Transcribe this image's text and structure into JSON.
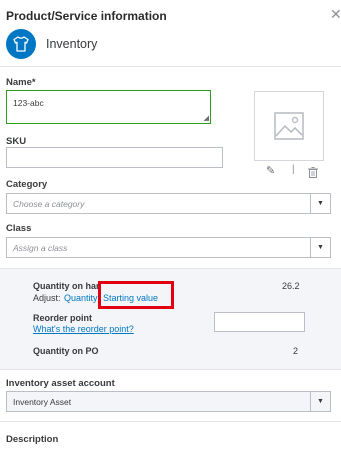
{
  "header": {
    "title": "Product/Service information"
  },
  "item_type": {
    "label": "Inventory"
  },
  "name": {
    "label": "Name*",
    "value": "123-abc"
  },
  "sku": {
    "label": "SKU",
    "value": ""
  },
  "category": {
    "label": "Category",
    "placeholder": "Choose a category"
  },
  "class": {
    "label": "Class",
    "placeholder": "Assign a class"
  },
  "quantity": {
    "on_hand_label": "Quantity on han",
    "on_hand_value": "26.2",
    "adjust_label": "Adjust:",
    "quantity_link": "Quantity",
    "starting_value_link": "Starting value",
    "reorder_label": "Reorder point",
    "reorder_help": "What's the reorder point?",
    "reorder_value": "",
    "on_po_label": "Quantity on PO",
    "on_po_value": "2"
  },
  "asset_account": {
    "label": "Inventory asset account",
    "value": "Inventory Asset"
  },
  "description": {
    "label": "Description"
  },
  "colors": {
    "accent": "#0077c5",
    "focus": "#2ca01c",
    "highlight": "#e00012"
  }
}
